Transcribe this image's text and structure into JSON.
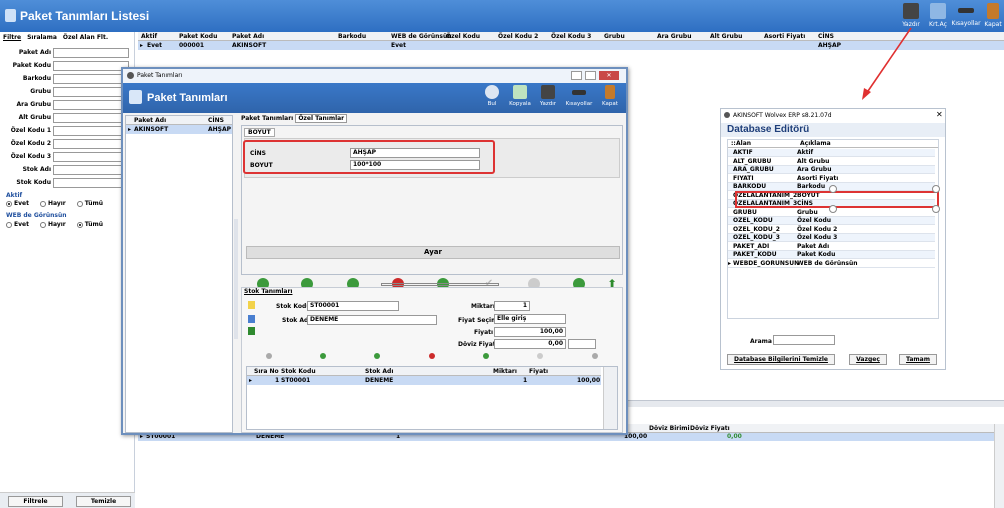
{
  "app": {
    "title": "Paket Tanımları Listesi",
    "toolbar": [
      "Yazdır",
      "Krt.Aç",
      "Kısayollar",
      "Kapat"
    ]
  },
  "left": {
    "tabs": [
      "Filtre",
      "Sıralama",
      "Özel Alan Flt."
    ],
    "fields": [
      "Paket Adı",
      "Paket Kodu",
      "Barkodu",
      "Grubu",
      "Ara Grubu",
      "Alt Grubu",
      "Özel Kodu 1",
      "Özel Kodu 2",
      "Özel Kodu 3",
      "Stok Adı",
      "Stok Kodu"
    ],
    "aktif_label": "Aktif",
    "web_label": "WEB de Görünsün",
    "radio": [
      "Evet",
      "Hayır",
      "Tümü"
    ],
    "filtre_btn": "Filtrele",
    "temizle_btn": "Temizle"
  },
  "grid": {
    "headers": [
      "Aktif",
      "Paket Kodu",
      "Paket Adı",
      "Barkodu",
      "WEB de Görünsün",
      "Özel Kodu",
      "Özel Kodu 2",
      "Özel Kodu 3",
      "Grubu",
      "Ara Grubu",
      "Alt Grubu",
      "Asorti Fiyatı",
      "CİNS"
    ],
    "row": {
      "aktif": "Evet",
      "kod": "000001",
      "ad": "AKINSOFT",
      "web": "Evet",
      "cins": "AHŞAP"
    }
  },
  "dialog": {
    "wtitle": "Paket Tanımları",
    "title": "Paket Tanımları",
    "buttons": [
      "Bul",
      "Kopyala",
      "Yazdır",
      "Kısayollar",
      "Kapat"
    ],
    "list_headers": [
      "Paket Adı",
      "CİNS"
    ],
    "list_row": {
      "ad": "AKINSOFT",
      "cins": "AHŞAP"
    },
    "tabs": [
      "Paket Tanımları",
      "Özel Tanımlar"
    ],
    "subtab": "BOYUT",
    "cins_label": "CİNS",
    "cins_value": "AHŞAP",
    "boyut_label": "BOYUT",
    "boyut_value": "100*100",
    "ayar": "Ayar",
    "stok_tab": "Stok Tanımları",
    "stok_kodu_label": "Stok Kodu",
    "stok_kodu": "ST00001",
    "stok_adi_label": "Stok Adı",
    "stok_adi": "DENEME",
    "miktar_label": "Miktarı",
    "miktar": "1",
    "fiyat_secimi_label": "Fiyat Seçimi",
    "fiyat_secimi": "Elle giriş",
    "fiyat_label": "Fiyatı",
    "fiyat": "100,00",
    "doviz_label": "Döviz Fiyatı",
    "doviz": "0,00",
    "tbl_headers": [
      "Sıra No",
      "Stok Kodu",
      "Stok Adı",
      "Miktarı",
      "Fiyatı"
    ],
    "tbl_row": {
      "sira": "1",
      "kod": "ST00001",
      "ad": "DENEME",
      "miktar": "1",
      "fiyat": "100,00"
    }
  },
  "behind": {
    "headers": [
      "Döviz Birimi",
      "Döviz Fiyatı"
    ],
    "row": {
      "kod": "ST00001",
      "ad": "DENEME",
      "miktar": "1",
      "fiyat": "100,00",
      "doviz": "0,00"
    }
  },
  "dbeditor": {
    "wtitle": "AKINSOFT Wolvex ERP s8.21.07d",
    "title": "Database Editörü",
    "headers": [
      "Alan",
      "Açıklama"
    ],
    "rows": [
      [
        "AKTIF",
        "Aktif"
      ],
      [
        "ALT_GRUBU",
        "Alt Grubu"
      ],
      [
        "ARA_GRUBU",
        "Ara Grubu"
      ],
      [
        "FIYATI",
        "Asorti Fiyatı"
      ],
      [
        "BARKODU",
        "Barkodu"
      ],
      [
        "OZELALANTANIM_2",
        "BOYUT"
      ],
      [
        "OZELALANTANIM_3",
        "CİNS"
      ],
      [
        "GRUBU",
        "Grubu"
      ],
      [
        "OZEL_KODU",
        "Özel Kodu"
      ],
      [
        "OZEL_KODU_2",
        "Özel Kodu 2"
      ],
      [
        "OZEL_KODU_3",
        "Özel Kodu 3"
      ],
      [
        "PAKET_ADI",
        "Paket Adı"
      ],
      [
        "PAKET_KODU",
        "Paket Kodu"
      ],
      [
        "WEBDE_GORUNSUN",
        "WEB de Görünsün"
      ]
    ],
    "arama_label": "Arama",
    "btn_temizle": "Database Bilgilerini Temizle",
    "btn_vazgec": "Vazgeç",
    "btn_tamam": "Tamam"
  }
}
